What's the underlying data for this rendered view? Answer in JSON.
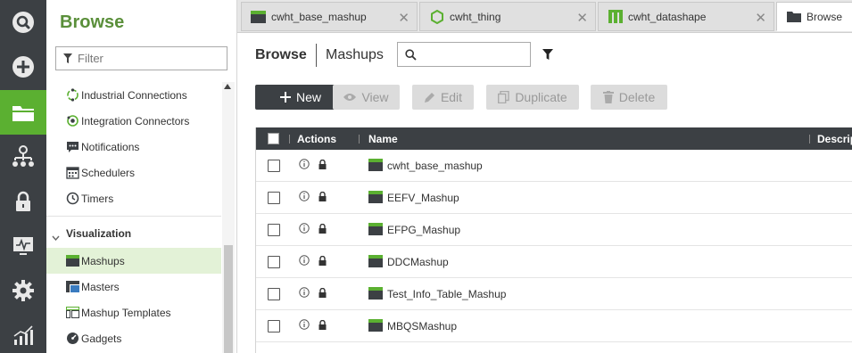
{
  "rail": {
    "items": [
      {
        "name": "search"
      },
      {
        "name": "add"
      },
      {
        "name": "browse",
        "active": true
      },
      {
        "name": "hierarchy"
      },
      {
        "name": "security"
      },
      {
        "name": "monitoring"
      },
      {
        "name": "settings"
      },
      {
        "name": "analytics"
      }
    ]
  },
  "browse": {
    "title": "Browse",
    "filter_placeholder": "Filter",
    "items": [
      {
        "label": "Industrial Connections",
        "icon": "connection-icon"
      },
      {
        "label": "Integration Connectors",
        "icon": "connector-icon"
      },
      {
        "label": "Notifications",
        "icon": "notification-icon"
      },
      {
        "label": "Schedulers",
        "icon": "calendar-icon"
      },
      {
        "label": "Timers",
        "icon": "clock-icon"
      }
    ],
    "group": {
      "label": "Visualization",
      "items": [
        {
          "label": "Mashups",
          "icon": "mashup-icon",
          "selected": true
        },
        {
          "label": "Masters",
          "icon": "master-icon"
        },
        {
          "label": "Mashup Templates",
          "icon": "template-icon"
        },
        {
          "label": "Gadgets",
          "icon": "gadget-icon"
        }
      ]
    }
  },
  "tabs": [
    {
      "label": "cwht_base_mashup",
      "icon": "mashup-icon",
      "close": "✕"
    },
    {
      "label": "cwht_thing",
      "icon": "thing-icon",
      "close": "✕"
    },
    {
      "label": "cwht_datashape",
      "icon": "datashape-icon",
      "close": "✕"
    },
    {
      "label": "Browse",
      "icon": "folder-icon",
      "active": true
    }
  ],
  "main": {
    "breadcrumb": "Browse",
    "section": "Mashups",
    "search_value": "",
    "toolbar": {
      "new_label": "New",
      "view_label": "View",
      "edit_label": "Edit",
      "duplicate_label": "Duplicate",
      "delete_label": "Delete"
    },
    "grid": {
      "columns": [
        "Actions",
        "Name",
        "Descrip"
      ],
      "rows": [
        {
          "name": "cwht_base_mashup"
        },
        {
          "name": "EEFV_Mashup"
        },
        {
          "name": "EFPG_Mashup"
        },
        {
          "name": "DDCMashup"
        },
        {
          "name": "Test_Info_Table_Mashup"
        },
        {
          "name": "MBQSMashup"
        }
      ]
    }
  },
  "colors": {
    "rail_bg": "#3c4044",
    "accent_green": "#5bb031",
    "title_green": "#5a8f3a",
    "selected_bg": "#e3f2d7",
    "header_dark": "#3c4044"
  }
}
